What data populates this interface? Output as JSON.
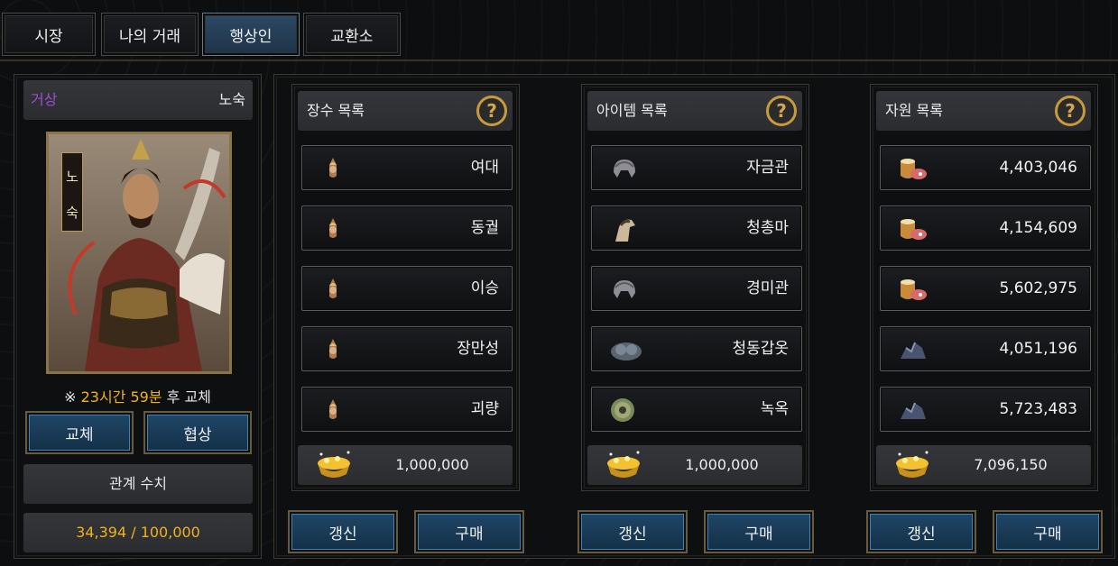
{
  "tabs": [
    {
      "label": "시장"
    },
    {
      "label": "나의 거래"
    },
    {
      "label": "행상인"
    },
    {
      "label": "교환소"
    }
  ],
  "merchant": {
    "type_label": "거상",
    "name": "노숙",
    "portrait_caption": [
      "노",
      "숙"
    ],
    "timer_prefix": "※",
    "timer_value": "23시간 59분",
    "timer_suffix": "후 교체",
    "replace_button": "교체",
    "negotiate_button": "협상",
    "relation_label": "관계 수치",
    "relation_value": "34,394 / 100,000"
  },
  "lists": [
    {
      "title": "장수 목록",
      "items": [
        {
          "name": "여대",
          "icon": "general-helmet-icon"
        },
        {
          "name": "동궐",
          "icon": "general-helmet-icon"
        },
        {
          "name": "이승",
          "icon": "general-helmet-icon"
        },
        {
          "name": "장만성",
          "icon": "general-helmet-icon"
        },
        {
          "name": "괴량",
          "icon": "general-helmet-icon"
        }
      ],
      "price": "1,000,000",
      "refresh_button": "갱신",
      "buy_button": "구매"
    },
    {
      "title": "아이템 목록",
      "items": [
        {
          "name": "자금관",
          "icon": "helmet-icon"
        },
        {
          "name": "청총마",
          "icon": "horse-icon"
        },
        {
          "name": "경미관",
          "icon": "helmet-icon"
        },
        {
          "name": "청동갑옷",
          "icon": "armor-icon"
        },
        {
          "name": "녹옥",
          "icon": "jade-icon"
        }
      ],
      "price": "1,000,000",
      "refresh_button": "갱신",
      "buy_button": "구매"
    },
    {
      "title": "자원 목록",
      "items": [
        {
          "name": "4,403,046",
          "icon": "food-icon"
        },
        {
          "name": "4,154,609",
          "icon": "food-icon"
        },
        {
          "name": "5,602,975",
          "icon": "food-icon"
        },
        {
          "name": "4,051,196",
          "icon": "ore-icon"
        },
        {
          "name": "5,723,483",
          "icon": "ore-icon"
        }
      ],
      "price": "7,096,150",
      "refresh_button": "갱신",
      "buy_button": "구매"
    }
  ],
  "colors": {
    "purple": "#9b4fd0",
    "gold": "#f2b21c",
    "active_tab": "#2e4a66"
  }
}
